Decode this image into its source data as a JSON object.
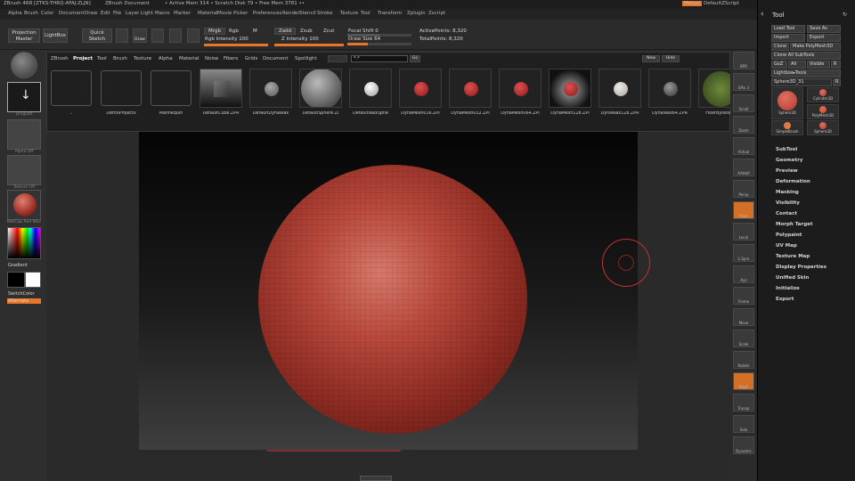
{
  "titlebar": {
    "app": "ZBrush 4R8 [ZTKS-THRQ-AFAJ-ZLJN]",
    "document": "ZBrush Document",
    "stats": "• Active Mem 314 • Scratch Disk 79 • Free Mem 3781 ••",
    "menus_button": "Menus",
    "script": "DefaultZScript"
  },
  "menubar": [
    "Alpha",
    "Brush",
    "Color",
    "Document",
    "Draw",
    "Edit",
    "File",
    "Layer",
    "Light",
    "Macro",
    "Marker",
    "Material",
    "Movie",
    "Picker",
    "Preferences",
    "Render",
    "Stencil",
    "Stroke",
    "Texture",
    "Tool",
    "Transform",
    "Zplugin",
    "Zscript"
  ],
  "topbar": {
    "projection_master": "Projection Master",
    "lightbox": "LightBox",
    "quick_sketch": "Quick Sketch",
    "draw": "Draw",
    "mrgb": "Mrgb",
    "rgb": "Rgb",
    "m": "M",
    "zadd": "Zadd",
    "zsub": "Zsub",
    "zcut": "Zcut",
    "rgb_intensity": "Rgb Intensity 100",
    "z_intensity": "Z Intensity 100",
    "focal_shift": "Focal Shift 0",
    "draw_size": "Draw Size 64",
    "active_points": "ActivePoints: 8,320",
    "total_points": "TotalPoints: 8,320",
    "rgb_intensity_value": 100,
    "z_intensity_value": 100,
    "draw_size_value": 64
  },
  "leftpanel": {
    "gradient": "Gradient",
    "switch_color": "SwitchColor",
    "alternate": "Alternate",
    "alpha_off": "Alpha Off",
    "texture_off": "Texture Off",
    "matcap": "MatCap Red Wax"
  },
  "lightbox": {
    "tabs": [
      "ZBrush",
      "Project",
      "Tool",
      "Brush",
      "Texture",
      "Alpha",
      "Material",
      "Noise",
      "Fibers",
      "Grids",
      "Document",
      "Spotlight"
    ],
    "active_tab": "Project",
    "search_value": "*.*",
    "go": "Go",
    "new": "New",
    "hide": "Hide",
    "items": [
      "..",
      "DemoProjects",
      "Mannequin",
      "DefaultCube.ZPR",
      "DefaultDynaWax",
      "DefaultSphere.Zi",
      "DefaultWaxSphe",
      "DynaMesh016.ZPI",
      "DynaMesh032.ZPI",
      "DynaMesh064.ZPI",
      "DynaMesh128.ZPI",
      "DynaWax128.ZPR",
      "DynaWax64.ZPR",
      "FiberByNoise"
    ]
  },
  "righttools": [
    "BPR",
    "SPix 3",
    "Scroll",
    "Zoom",
    "Actual",
    "AAHalf",
    "Persp",
    "Floor",
    "Local",
    "L.Sym",
    "Xyz",
    "Frame",
    "Move",
    "Scale",
    "Rotate",
    "PolyF",
    "Transp",
    "Solo",
    "Dynamic"
  ],
  "tooltray": {
    "title": "Tool",
    "load_tool": "Load Tool",
    "save_as": "Save As",
    "import": "Import",
    "export": "Export",
    "clone": "Clone",
    "make_polymesh": "Make PolyMesh3D",
    "clone_all_subtools": "Clone All SubTools",
    "goz": "GoZ",
    "all": "All",
    "visible": "Visible",
    "r": "R",
    "lightbox_tools": "Lightbox▸Tools",
    "current_tool": "Sphere3D_31",
    "thumbs": [
      "Sphere3D",
      "Cylinder3D",
      "PolyMesh3D",
      "SimpleBrush",
      "Sphere3D"
    ],
    "sections": [
      "SubTool",
      "Geometry",
      "Preview",
      "Deformation",
      "Masking",
      "Visibility",
      "Contact",
      "Morph Target",
      "Polypaint",
      "UV Map",
      "Texture Map",
      "Display Properties",
      "Unified Skin",
      "Initialize",
      "Export"
    ]
  },
  "colors": {
    "accent": "#e8762a",
    "sphere": "#b9493c",
    "cursor": "#c23030"
  }
}
